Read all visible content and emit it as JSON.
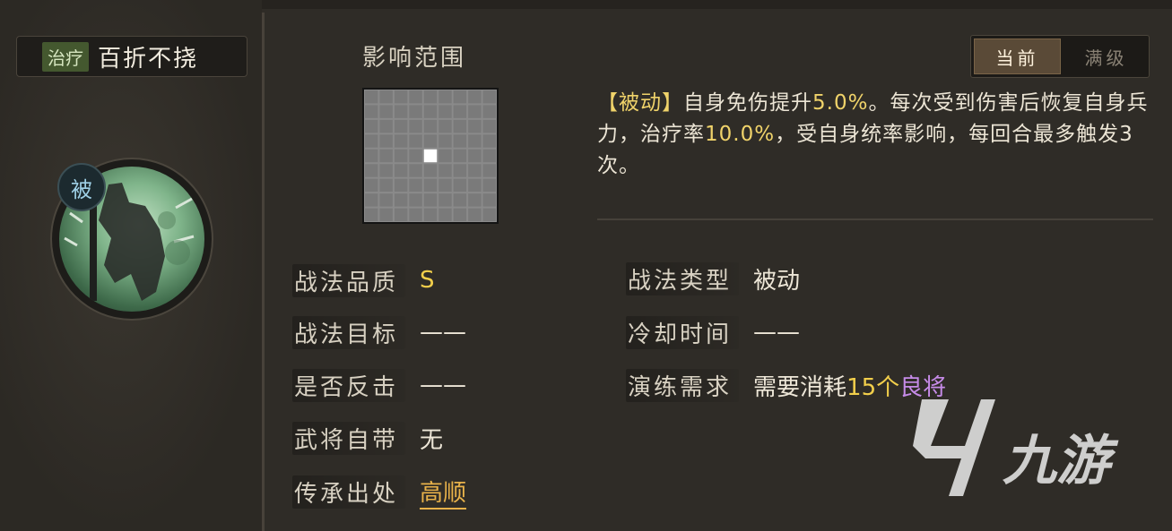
{
  "skill": {
    "type_tag": "治疗",
    "name": "百折不挠",
    "passive_badge": "被"
  },
  "range": {
    "label": "影响范围",
    "grid_size": 9
  },
  "tabs": {
    "current": "当前",
    "max": "满级"
  },
  "description": {
    "prefix": "【被动】",
    "part1": "自身免伤提升",
    "value1": "5.0%",
    "part2": "。每次受到伤害后恢复自身兵力，治疗率",
    "value2": "10.0%",
    "part3": "，受自身统率影响，每回合最多触发3次。"
  },
  "attributes_left": [
    {
      "label": "战法品质",
      "value": "S"
    },
    {
      "label": "战法目标",
      "value": "——"
    },
    {
      "label": "是否反击",
      "value": "——"
    },
    {
      "label": "武将自带",
      "value": "无"
    },
    {
      "label": "传承出处",
      "value": "高顺"
    }
  ],
  "attributes_right": [
    {
      "label": "战法类型",
      "value": "被动"
    },
    {
      "label": "冷却时间",
      "value": "——"
    },
    {
      "label": "演练需求",
      "value": "需要消耗",
      "count": "15个",
      "item": "良将"
    }
  ],
  "watermark": {
    "text": "九游"
  },
  "colors": {
    "highlight": "#f0d36a",
    "accent_orange": "#e8b24a",
    "accent_purple": "#c68be8",
    "heal_tag": "#44582f"
  }
}
